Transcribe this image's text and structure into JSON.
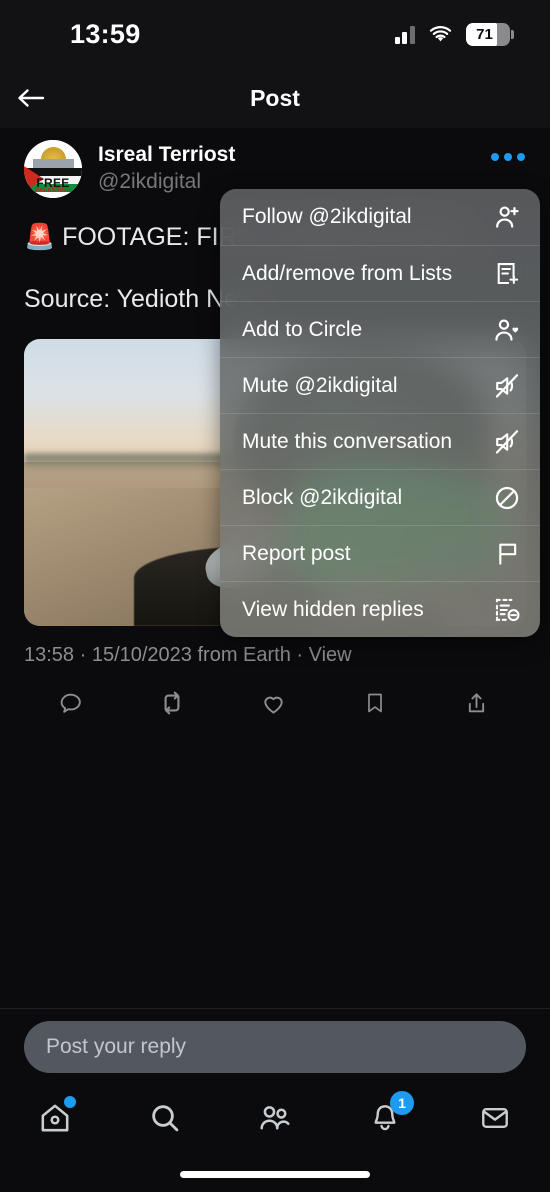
{
  "status_bar": {
    "time": "13:59",
    "battery_level": "71",
    "icons": [
      "signal-bars-icon",
      "wifi-icon",
      "battery-icon"
    ]
  },
  "header": {
    "title": "Post",
    "back_icon": "back-arrow-icon"
  },
  "post": {
    "display_name": "Isreal Terriost",
    "handle": "@2ikdigital",
    "avatar_text_main": "FREE",
    "avatar_text_sub": "PALESTINE",
    "more_icon": "more-options-icon",
    "text": "🚨 FOOTAGE: FIRST HAMAS ATTACK",
    "source_line": "Source: Yedioth News",
    "media_mute_icon": "volume-mute-icon",
    "meta": "13:58 · 15/10/2023 from Earth · View",
    "actions": [
      {
        "name": "reply",
        "icon": "comment-icon"
      },
      {
        "name": "repost",
        "icon": "retweet-icon"
      },
      {
        "name": "like",
        "icon": "heart-icon"
      },
      {
        "name": "bookmark",
        "icon": "bookmark-icon"
      },
      {
        "name": "share",
        "icon": "share-icon"
      }
    ]
  },
  "context_menu": {
    "items": [
      {
        "label": "Follow @2ikdigital",
        "icon": "person-plus-icon"
      },
      {
        "label": "Add/remove from Lists",
        "icon": "list-plus-icon"
      },
      {
        "label": "Add to Circle",
        "icon": "person-heart-icon"
      },
      {
        "label": "Mute @2ikdigital",
        "icon": "speaker-mute-icon"
      },
      {
        "label": "Mute this conversation",
        "icon": "speaker-mute-icon"
      },
      {
        "label": "Block @2ikdigital",
        "icon": "block-circle-icon"
      },
      {
        "label": "Report post",
        "icon": "flag-icon"
      },
      {
        "label": "View hidden replies",
        "icon": "hidden-replies-icon"
      }
    ]
  },
  "reply_bar": {
    "placeholder": "Post your reply",
    "value": ""
  },
  "bottom_nav": {
    "items": [
      {
        "name": "home",
        "icon": "home-icon",
        "badge_dot": true
      },
      {
        "name": "search",
        "icon": "search-icon"
      },
      {
        "name": "communities",
        "icon": "communities-icon"
      },
      {
        "name": "notifications",
        "icon": "bell-icon",
        "badge_count": "1"
      },
      {
        "name": "messages",
        "icon": "envelope-icon"
      }
    ]
  },
  "colors": {
    "accent_blue": "#1d9bf0",
    "background": "#0b0b0d",
    "secondary_text": "#76787c"
  }
}
